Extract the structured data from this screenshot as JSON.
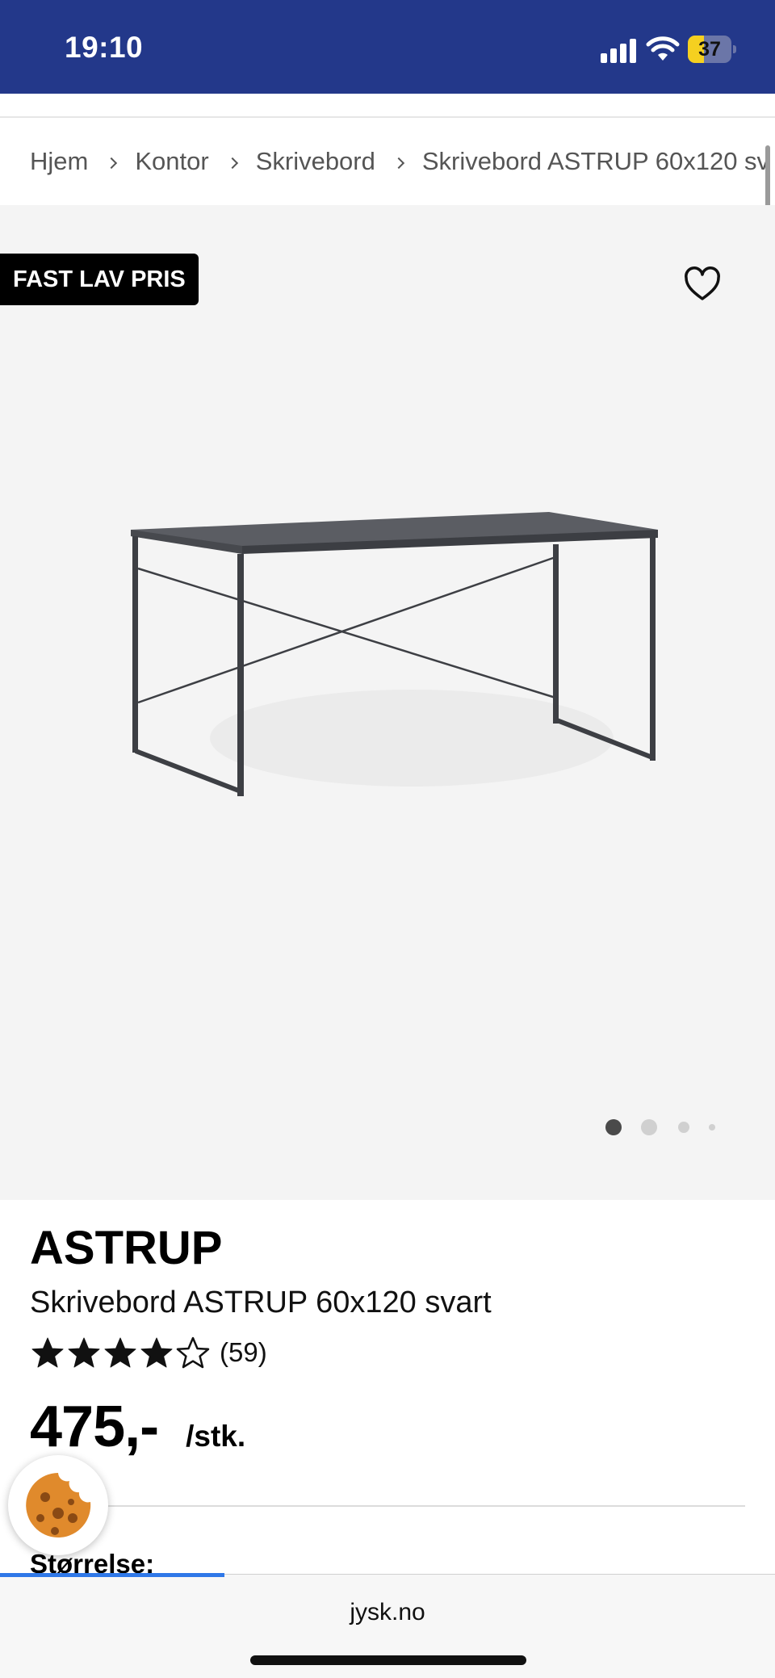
{
  "status_bar": {
    "time": "19:10",
    "battery": "37",
    "battery_level": 0.37,
    "icons": [
      "signal-icon",
      "wifi-icon",
      "battery-icon"
    ]
  },
  "breadcrumb": {
    "items": [
      "Hjem",
      "Kontor",
      "Skrivebord",
      "Skrivebord ASTRUP 60x120 sv"
    ]
  },
  "gallery": {
    "badge": "FAST LAV PRIS",
    "favorite_icon": "heart-outline-icon",
    "image_alt": "desk-image",
    "dot_count": 4,
    "active_dot": 0
  },
  "product": {
    "brand": "ASTRUP",
    "title": "Skrivebord ASTRUP 60x120 svart",
    "rating_stars": 4,
    "rating_max": 5,
    "rating_count": "(59)",
    "price": "475,-",
    "unit": "/stk.",
    "size_label": "Størrelse:"
  },
  "cookie": {
    "icon": "cookie-icon"
  },
  "browser": {
    "url": "jysk.no",
    "load_progress": 0.29
  },
  "colors": {
    "brand_blue": "#23388a",
    "badge_bg": "#000000",
    "gallery_bg": "#f4f4f4",
    "progress": "#2f78e8"
  }
}
